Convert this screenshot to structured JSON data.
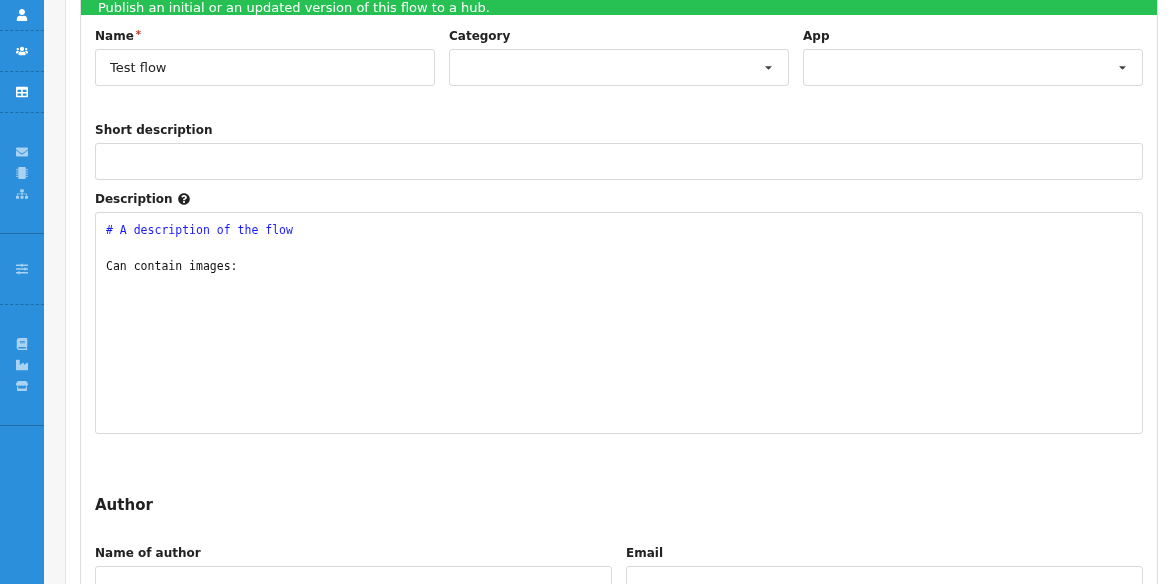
{
  "banner": {
    "text": "Publish an initial or an updated version of this flow to a hub."
  },
  "top_row": [
    {
      "label": "Name",
      "required_mark": "*",
      "kind": "text",
      "value": "Test flow"
    },
    {
      "label": "Category",
      "kind": "select"
    },
    {
      "label": "App",
      "kind": "select"
    }
  ],
  "short_description": {
    "label": "Short description"
  },
  "description": {
    "label": "Description",
    "lines": [
      {
        "kind": "heading",
        "text": "# A description of the flow"
      },
      {
        "kind": "blank"
      },
      {
        "kind": "plain",
        "text": "Can contain images:"
      }
    ]
  },
  "author_section": {
    "title": "Author",
    "fields": [
      {
        "label": "Name of author"
      },
      {
        "label": "Email"
      }
    ]
  }
}
